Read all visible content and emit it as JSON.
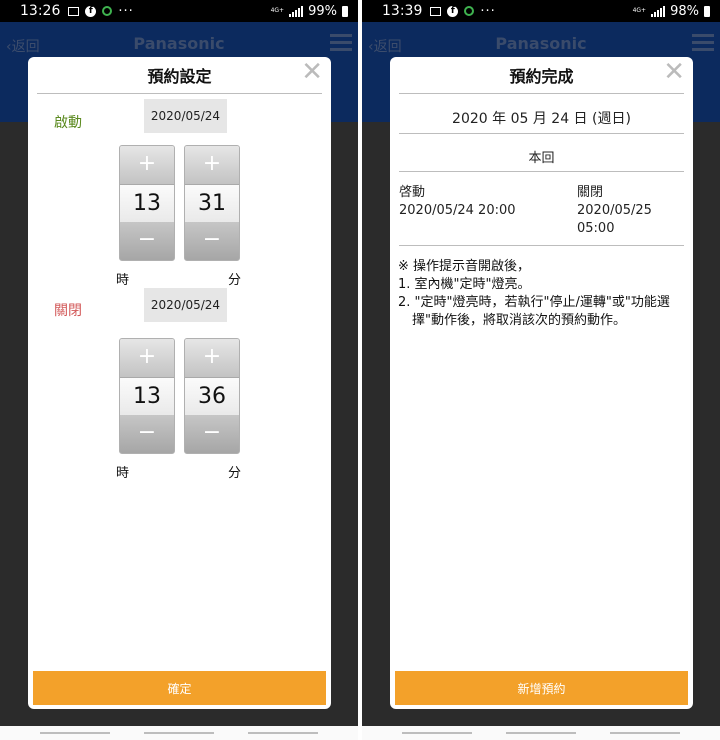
{
  "left": {
    "status": {
      "time": "13:26",
      "dots": "···",
      "network": "4G+",
      "battery": "99%"
    },
    "appbar": {
      "back": "返回",
      "brand": "Panasonic"
    },
    "dialog": {
      "title": "預約設定",
      "close": "✕",
      "start": {
        "label": "啟動",
        "date": "2020/05/24",
        "hour": "13",
        "minute": "31"
      },
      "end": {
        "label": "關閉",
        "date": "2020/05/24",
        "hour": "13",
        "minute": "36"
      },
      "hour_unit": "時",
      "minute_unit": "分",
      "plus": "+",
      "minus": "−",
      "confirm_label": "確定"
    }
  },
  "right": {
    "status": {
      "time": "13:39",
      "dots": "···",
      "network": "4G+",
      "battery": "98%"
    },
    "appbar": {
      "back": "返回",
      "brand": "Panasonic"
    },
    "dialog": {
      "title": "預約完成",
      "close": "✕",
      "date_line": "2020 年 05 月 24 日 (週日)",
      "frequency": "本回",
      "start_label": "啓動",
      "start_value": "2020/05/24 20:00",
      "end_label": "關閉",
      "end_value_line1": "2020/05/25",
      "end_value_line2": "05:00",
      "note_title": "※ 操作提示音開啟後，",
      "note_1": "1. 室內機\"定時\"燈亮。",
      "note_2": "2. \"定時\"燈亮時，若執行\"停止/運轉\"或\"功能選擇\"動作後，將取消該次的預約動作。",
      "add_label": "新增預約"
    }
  }
}
